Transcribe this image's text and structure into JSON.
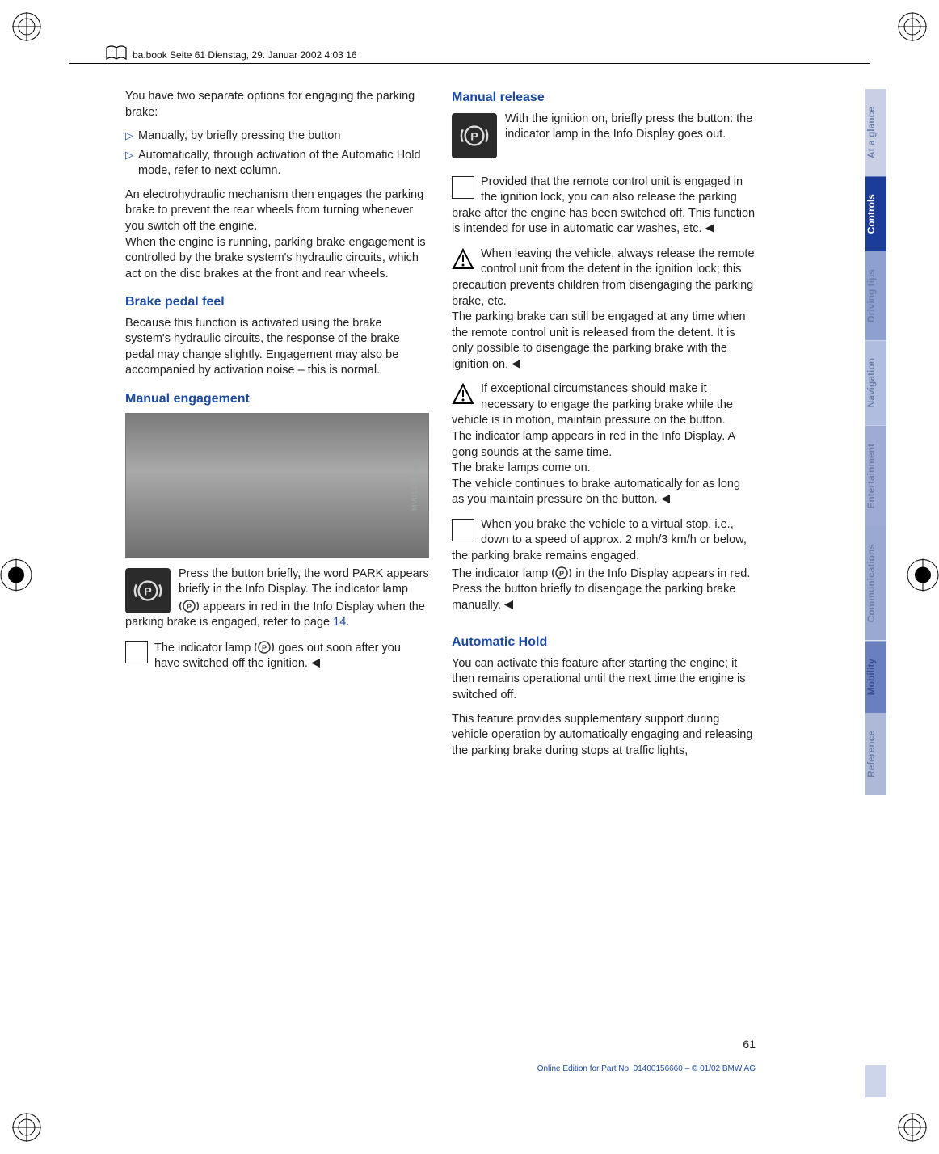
{
  "meta": {
    "header": "ba.book  Seite 61  Dienstag, 29. Januar 2002  4:03 16",
    "page_number": "61",
    "footer": "Online Edition for Part No. 01400156660 – © 01/02 BMW AG",
    "photo_code": "MV01239UEA"
  },
  "tabs": [
    "At a glance",
    "Controls",
    "Driving tips",
    "Navigation",
    "Entertainment",
    "Communications",
    "Mobility",
    "Reference"
  ],
  "col1": {
    "intro": "You have two separate options for engaging the parking brake:",
    "b1": "Manually, by briefly pressing the button",
    "b2": "Automatically, through activation of the Automatic Hold mode, refer to next column.",
    "p1": "An electrohydraulic mechanism then engages the parking brake to prevent the rear wheels from turning whenever you switch off the engine.",
    "p1b": "When the engine is running, parking brake engagement is controlled by the brake system's hydraulic circuits, which act on the disc brakes at the front and rear wheels.",
    "h1": "Brake pedal feel",
    "p2": "Because this function is activated using the brake system's hydraulic circuits, the response of the brake pedal may change slightly. Engagement may also be accompanied by activation noise – this is normal.",
    "h2": "Manual engagement",
    "p3a": "Press the button briefly, the word PARK appears briefly in the Info Display. The indicator lamp ",
    "p3b": " appears in red in the Info Display when the parking brake is engaged, refer to page ",
    "p3_link": "14",
    "p3c": ".",
    "p4a": "The indicator lamp ",
    "p4b": " goes out soon after you have switched off the ignition."
  },
  "col2": {
    "h1": "Manual release",
    "p1": "With the ignition on, briefly press the button: the indicator lamp in the Info Display goes out.",
    "p2": "Provided that the remote control unit is engaged in the ignition lock, you can also release the parking brake after the engine has been switched off. This function is intended for use in automatic car washes, etc.",
    "p3": "When leaving the vehicle, always release the remote control unit from the detent in the ignition lock; this precaution prevents children from disengaging the parking brake, etc.",
    "p3b": "The parking brake can still be engaged at any time when the remote control unit is released from the detent. It is only possible to disengage the parking brake with the ignition on.",
    "p4": "If exceptional circumstances should make it necessary to engage the parking brake while the vehicle is in motion, maintain pressure on the button.",
    "p4b": "The indicator lamp appears in red in the Info Display. A gong sounds at the same time.",
    "p4c": "The brake lamps come on.",
    "p4d": "The vehicle continues to brake automatically for as long as you maintain pressure on the button.",
    "p5a": "When you brake the vehicle to a virtual stop, i.e., down to a speed of approx. 2 mph/3 km/h or below, the parking brake remains engaged.",
    "p5b_pre": "The indicator lamp ",
    "p5b_post": " in the Info Display appears in red. Press the button briefly to disengage the parking brake manually.",
    "h2": "Automatic Hold",
    "p6": "You can activate this feature after starting the engine; it then remains operational until the next time the engine is switched off.",
    "p7": "This feature provides supplementary support during vehicle operation by automatically engaging and releasing the parking brake during stops at traffic lights,"
  }
}
